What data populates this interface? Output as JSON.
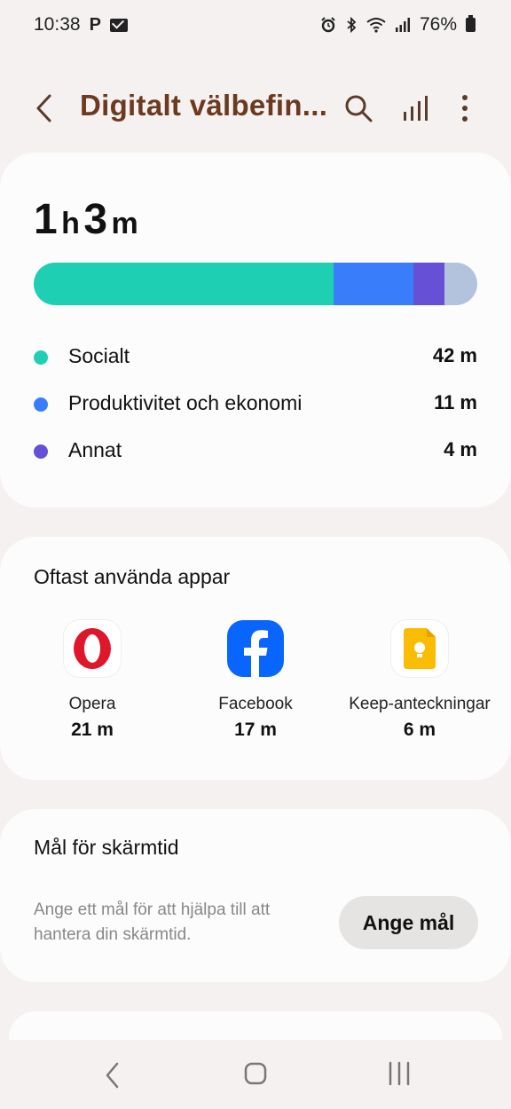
{
  "status_bar": {
    "time": "10:38",
    "notif_p": "P",
    "battery": "76%",
    "icons": [
      "mail-icon",
      "alarm-icon",
      "bluetooth-icon",
      "wifi-icon",
      "signal-icon",
      "battery-icon"
    ]
  },
  "app_bar": {
    "title": "Digitalt välbefin...",
    "icons": [
      "back-icon",
      "search-icon",
      "bar-chart-icon",
      "more-vert-icon"
    ]
  },
  "usage": {
    "hours": "1",
    "hours_unit": "h",
    "minutes": "3",
    "minutes_unit": "m",
    "bar_fractions": {
      "socialt": 0.675,
      "produktivitet": 0.18,
      "annat": 0.07,
      "other": 0.075
    },
    "colors": {
      "socialt": "#1fcfb4",
      "produktivitet": "#3a7dfb",
      "annat": "#6650d5",
      "other": "#b4c3dd"
    },
    "categories": [
      {
        "label": "Socialt",
        "value": "42 m"
      },
      {
        "label": "Produktivitet och ekonomi",
        "value": "11 m"
      },
      {
        "label": "Annat",
        "value": "4 m"
      }
    ]
  },
  "apps_section": {
    "heading": "Oftast använda appar",
    "apps": [
      {
        "name": "Opera",
        "time": "21 m"
      },
      {
        "name": "Facebook",
        "time": "17 m"
      },
      {
        "name": "Keep-anteckningar",
        "time": "6 m"
      }
    ]
  },
  "goal_section": {
    "heading": "Mål för skärmtid",
    "description": "Ange ett mål för att hjälpa till att hantera din skärmtid.",
    "button_label": "Ange mål"
  },
  "nav_bar": {
    "icons": [
      "nav-back-icon",
      "nav-home-icon",
      "nav-recents-icon"
    ]
  }
}
